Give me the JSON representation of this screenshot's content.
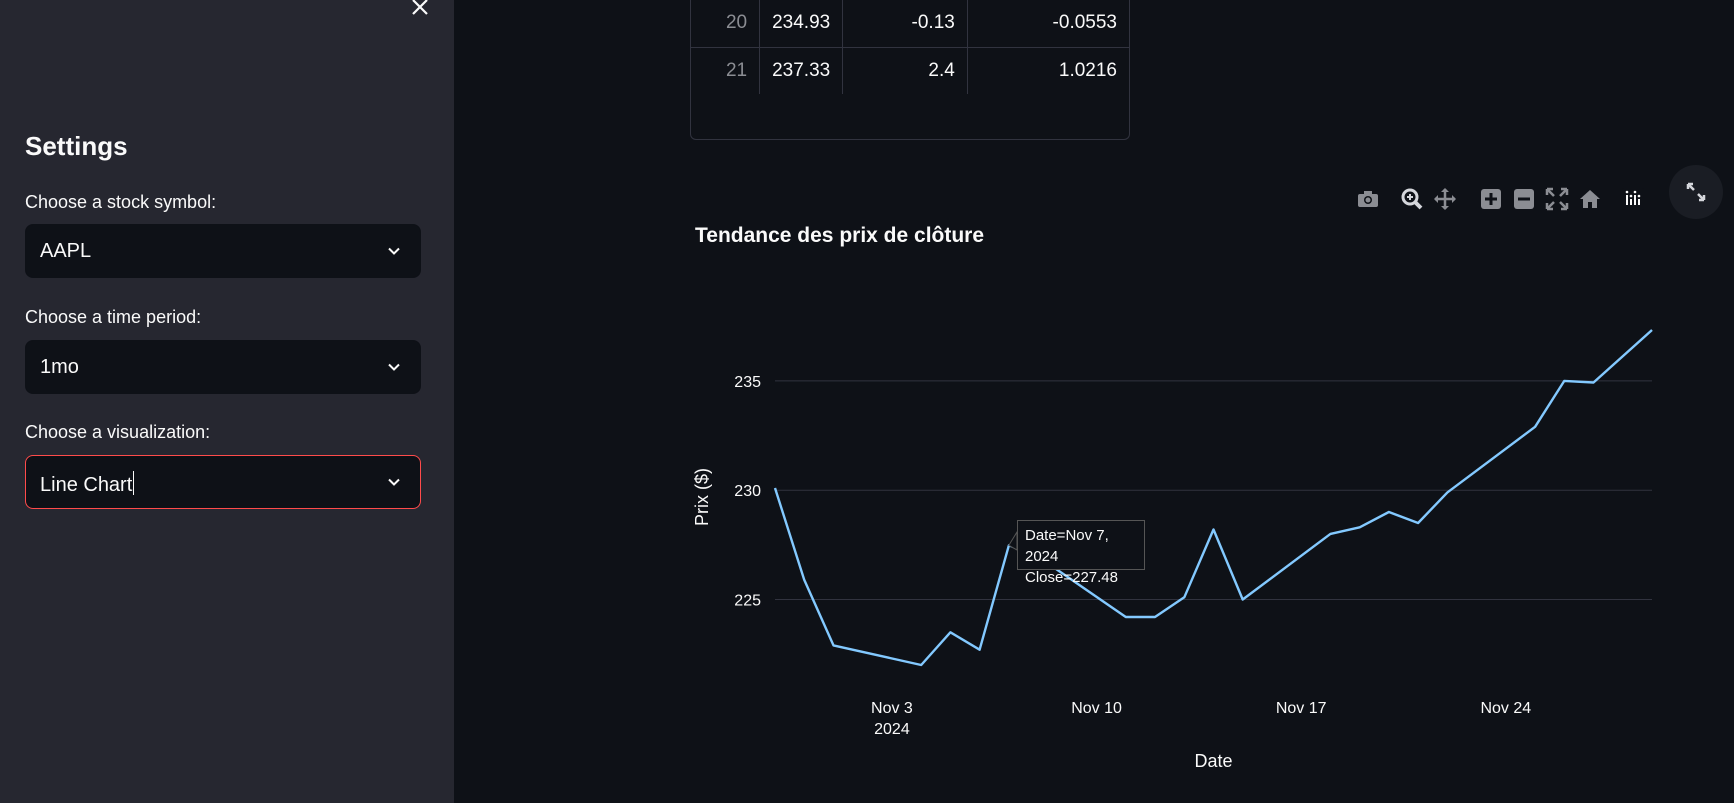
{
  "sidebar": {
    "title": "Settings",
    "fields": [
      {
        "label": "Choose a stock symbol:",
        "value": "AAPL"
      },
      {
        "label": "Choose a time period:",
        "value": "1mo"
      },
      {
        "label": "Choose a visualization:",
        "value": "Line Chart"
      }
    ]
  },
  "table": {
    "rows": [
      {
        "index": "20",
        "close": "234.93",
        "change": "-0.13",
        "pct": "-0.0553"
      },
      {
        "index": "21",
        "close": "237.33",
        "change": "2.4",
        "pct": "1.0216"
      }
    ]
  },
  "tooltip": {
    "line1": "Date=Nov 7, 2024",
    "line2": "Close=227.48"
  },
  "colors": {
    "line": "#83c9ff",
    "accent": "#ff4b4b",
    "grid": "#31333f"
  },
  "chart_data": {
    "type": "line",
    "title": "Tendance des prix de clôture",
    "xlabel": "Date",
    "ylabel": "Prix ($)",
    "x": [
      "2024-10-30",
      "2024-10-31",
      "2024-11-01",
      "2024-11-04",
      "2024-11-05",
      "2024-11-06",
      "2024-11-07",
      "2024-11-08",
      "2024-11-11",
      "2024-11-12",
      "2024-11-13",
      "2024-11-14",
      "2024-11-15",
      "2024-11-18",
      "2024-11-19",
      "2024-11-20",
      "2024-11-21",
      "2024-11-22",
      "2024-11-25",
      "2024-11-26",
      "2024-11-27",
      "2024-11-29"
    ],
    "series": [
      {
        "values": [
          230.1,
          225.9,
          222.9,
          222.0,
          223.5,
          222.7,
          227.48,
          226.96,
          224.2,
          224.2,
          225.1,
          228.2,
          225.0,
          228.0,
          228.3,
          229.0,
          228.5,
          229.9,
          232.9,
          235.0,
          234.93,
          237.33
        ]
      }
    ],
    "xticks": [
      {
        "date": "2024-11-03",
        "label": "Nov 3",
        "sub": "2024"
      },
      {
        "date": "2024-11-10",
        "label": "Nov 10",
        "sub": ""
      },
      {
        "date": "2024-11-17",
        "label": "Nov 17",
        "sub": ""
      },
      {
        "date": "2024-11-24",
        "label": "Nov 24",
        "sub": ""
      }
    ],
    "yticks": [
      225,
      230,
      235
    ],
    "xlim": [
      "2024-10-30",
      "2024-11-29"
    ],
    "ylim": [
      220.4,
      237.33
    ],
    "grid": true
  }
}
